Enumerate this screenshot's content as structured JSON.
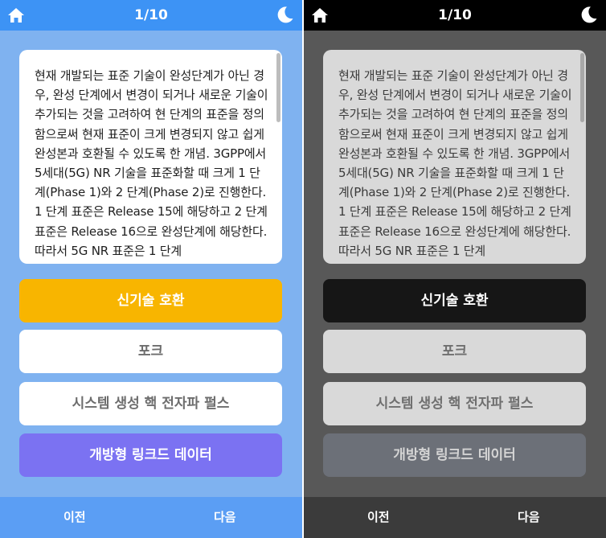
{
  "header": {
    "progress": "1/10"
  },
  "question_text": "현재 개발되는 표준 기술이 완성단계가 아닌 경우, 완성 단계에서 변경이 되거나 새로운 기술이 추가되는 것을 고려하여 현 단계의 표준을 정의함으로써 현재 표준이 크게 변경되지 않고 쉽게 완성본과 호환될 수 있도록 한 개념. 3GPP에서 5세대(5G) NR 기술을 표준화할 때 크게 1 단계(Phase 1)와 2 단계(Phase 2)로 진행한다. 1 단계 표준은 Release 15에 해당하고 2 단계 표준은 Release 16으로 완성단계에 해당한다. 따라서 5G NR 표준은 1 단계",
  "options": [
    {
      "label": "신기술 호환"
    },
    {
      "label": "포크"
    },
    {
      "label": "시스템 생성 핵 전자파 펄스"
    },
    {
      "label": "개방형 링크드 데이터"
    }
  ],
  "footer": {
    "prev_label": "이전",
    "next_label": "다음"
  },
  "icons": {
    "home": "home-icon",
    "theme_toggle": "moon-icon"
  },
  "colors": {
    "light_header": "#3d93f5",
    "light_background": "#7fb2f0",
    "highlight_option": "#f8b500",
    "accent_option": "#7b72f2",
    "dark_header": "#000000",
    "dark_background": "#585858"
  }
}
